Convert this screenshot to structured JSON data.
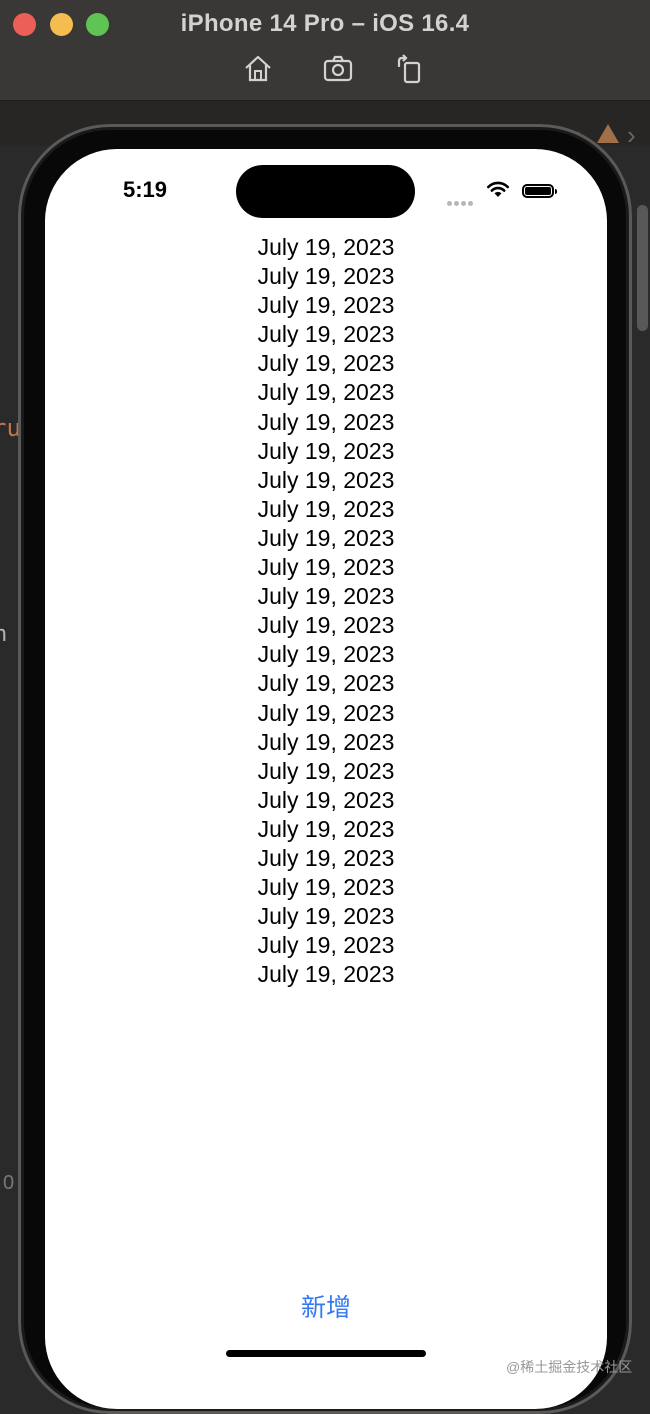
{
  "window": {
    "title": "iPhone 14 Pro – iOS 16.4"
  },
  "toolbar": {
    "icons": [
      "home-icon",
      "screenshot-icon",
      "rotate-icon"
    ]
  },
  "status_bar": {
    "time": "5:19"
  },
  "list": {
    "items": [
      "July 19, 2023",
      "July 19, 2023",
      "July 19, 2023",
      "July 19, 2023",
      "July 19, 2023",
      "July 19, 2023",
      "July 19, 2023",
      "July 19, 2023",
      "July 19, 2023",
      "July 19, 2023",
      "July 19, 2023",
      "July 19, 2023",
      "July 19, 2023",
      "July 19, 2023",
      "July 19, 2023",
      "July 19, 2023",
      "July 19, 2023",
      "July 19, 2023",
      "July 19, 2023",
      "July 19, 2023",
      "July 19, 2023",
      "July 19, 2023",
      "July 19, 2023",
      "July 19, 2023",
      "July 19, 2023",
      "July 19, 2023"
    ]
  },
  "actions": {
    "add_label": "新增"
  },
  "background": {
    "code_fragment_1": "ru",
    "code_fragment_2": "n",
    "code_fragment_3": "0"
  },
  "watermark": "@稀土掘金技术社区",
  "colors": {
    "accent": "#3478f6",
    "close": "#ec5f57",
    "minimize": "#f5bd4f",
    "maximize": "#5fc453"
  }
}
